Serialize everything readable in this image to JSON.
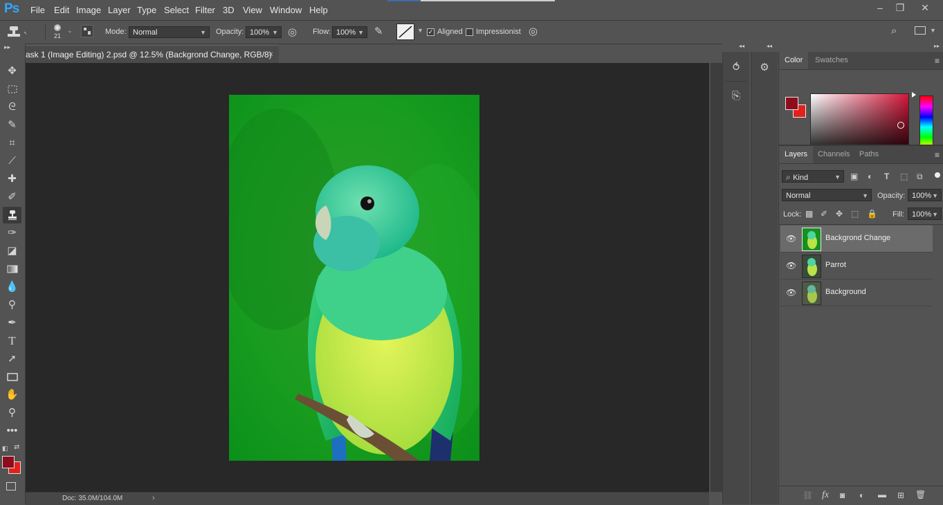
{
  "app": {
    "logo": "Ps"
  },
  "menu": [
    "File",
    "Edit",
    "Image",
    "Layer",
    "Type",
    "Select",
    "Filter",
    "3D",
    "View",
    "Window",
    "Help"
  ],
  "window_controls": {
    "minimize": "–",
    "restore": "❐",
    "close": "✕"
  },
  "options_bar": {
    "brush_size": "21",
    "mode_label": "Mode:",
    "mode_value": "Normal",
    "opacity_label": "Opacity:",
    "opacity_value": "100%",
    "flow_label": "Flow:",
    "flow_value": "100%",
    "aligned_label": "Aligned",
    "aligned_checked": true,
    "impressionist_label": "Impressionist",
    "impressionist_checked": false
  },
  "document": {
    "tab_title": "ask 1 (Image Editing) 2.psd @ 12.5% (Backgrond Change, RGB/8)",
    "close_glyph": "×",
    "status": "Doc: 35.0M/104.0M",
    "status_arrow": "›"
  },
  "color_panel": {
    "tabs": [
      "Color",
      "Swatches"
    ],
    "active_tab": "Color",
    "foreground": "#8e0d1c",
    "background": "#e0211c",
    "hue_color": "#d3173a"
  },
  "layers_panel": {
    "tabs": [
      "Layers",
      "Channels",
      "Paths"
    ],
    "active_tab": "Layers",
    "filter_kind": "Kind",
    "blend_mode": "Normal",
    "opacity_label": "Opacity:",
    "opacity_value": "100%",
    "lock_label": "Lock:",
    "fill_label": "Fill:",
    "fill_value": "100%",
    "layers": [
      {
        "name": "Backgrond Change",
        "selected": true,
        "visible": true
      },
      {
        "name": "Parrot",
        "selected": false,
        "visible": true
      },
      {
        "name": "Background",
        "selected": false,
        "visible": true
      }
    ]
  },
  "toolbar": {
    "foreground": "#8e0d1c",
    "background": "#e0211c",
    "active_tool": "clone-stamp"
  },
  "icons": {
    "eye": "👁",
    "panel_menu": "≡",
    "collapse": "◂◂",
    "expand": "▸▸"
  }
}
